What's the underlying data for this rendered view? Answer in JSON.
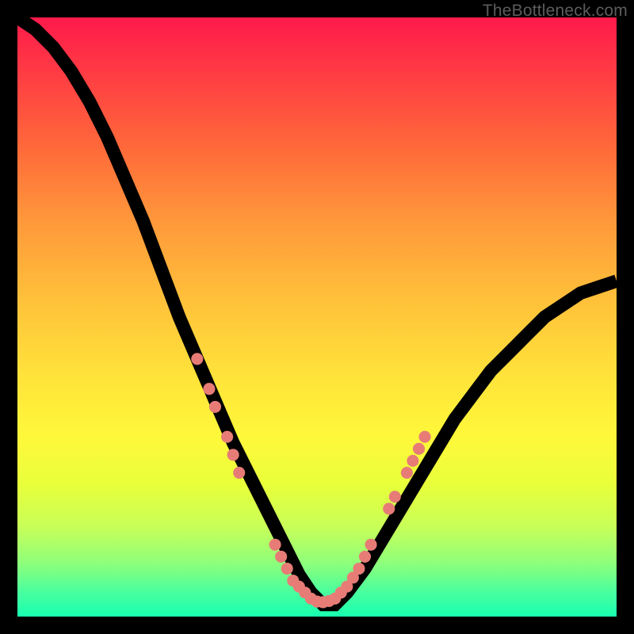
{
  "watermark": "TheBottleneck.com",
  "chart_data": {
    "type": "line",
    "title": "",
    "xlabel": "",
    "ylabel": "",
    "xlim": [
      0,
      100
    ],
    "ylim": [
      0,
      100
    ],
    "x": [
      0,
      3,
      6,
      9,
      12,
      15,
      18,
      21,
      24,
      27,
      30,
      33,
      36,
      39,
      42,
      45,
      47,
      49,
      51,
      53,
      55,
      58,
      61,
      64,
      67,
      70,
      73,
      76,
      79,
      82,
      85,
      88,
      91,
      94,
      97,
      100
    ],
    "values": [
      100,
      98,
      95,
      91,
      86,
      80,
      73,
      66,
      58,
      50,
      43,
      36,
      29,
      23,
      17,
      11,
      7,
      4,
      2,
      2,
      4,
      8,
      13,
      18,
      23,
      28,
      33,
      37,
      41,
      44,
      47,
      50,
      52,
      54,
      55,
      56
    ],
    "markers": [
      {
        "x": 30,
        "y": 43
      },
      {
        "x": 32,
        "y": 38
      },
      {
        "x": 33,
        "y": 35
      },
      {
        "x": 35,
        "y": 30
      },
      {
        "x": 36,
        "y": 27
      },
      {
        "x": 37,
        "y": 24
      },
      {
        "x": 43,
        "y": 12
      },
      {
        "x": 44,
        "y": 10
      },
      {
        "x": 45,
        "y": 8
      },
      {
        "x": 46,
        "y": 6
      },
      {
        "x": 47,
        "y": 5
      },
      {
        "x": 48,
        "y": 4
      },
      {
        "x": 49,
        "y": 3
      },
      {
        "x": 50,
        "y": 2.5
      },
      {
        "x": 51,
        "y": 2.4
      },
      {
        "x": 52,
        "y": 2.6
      },
      {
        "x": 53,
        "y": 3
      },
      {
        "x": 54,
        "y": 4
      },
      {
        "x": 55,
        "y": 5
      },
      {
        "x": 56,
        "y": 6.5
      },
      {
        "x": 57,
        "y": 8
      },
      {
        "x": 58,
        "y": 10
      },
      {
        "x": 59,
        "y": 12
      },
      {
        "x": 62,
        "y": 18
      },
      {
        "x": 63,
        "y": 20
      },
      {
        "x": 65,
        "y": 24
      },
      {
        "x": 66,
        "y": 26
      },
      {
        "x": 67,
        "y": 28
      },
      {
        "x": 68,
        "y": 30
      }
    ],
    "gradient_stops": [
      {
        "pos": 0,
        "color": "#ff1a4b"
      },
      {
        "pos": 22,
        "color": "#ff6a3a"
      },
      {
        "pos": 48,
        "color": "#ffc33a"
      },
      {
        "pos": 70,
        "color": "#fff83a"
      },
      {
        "pos": 100,
        "color": "#18ffb0"
      }
    ]
  }
}
